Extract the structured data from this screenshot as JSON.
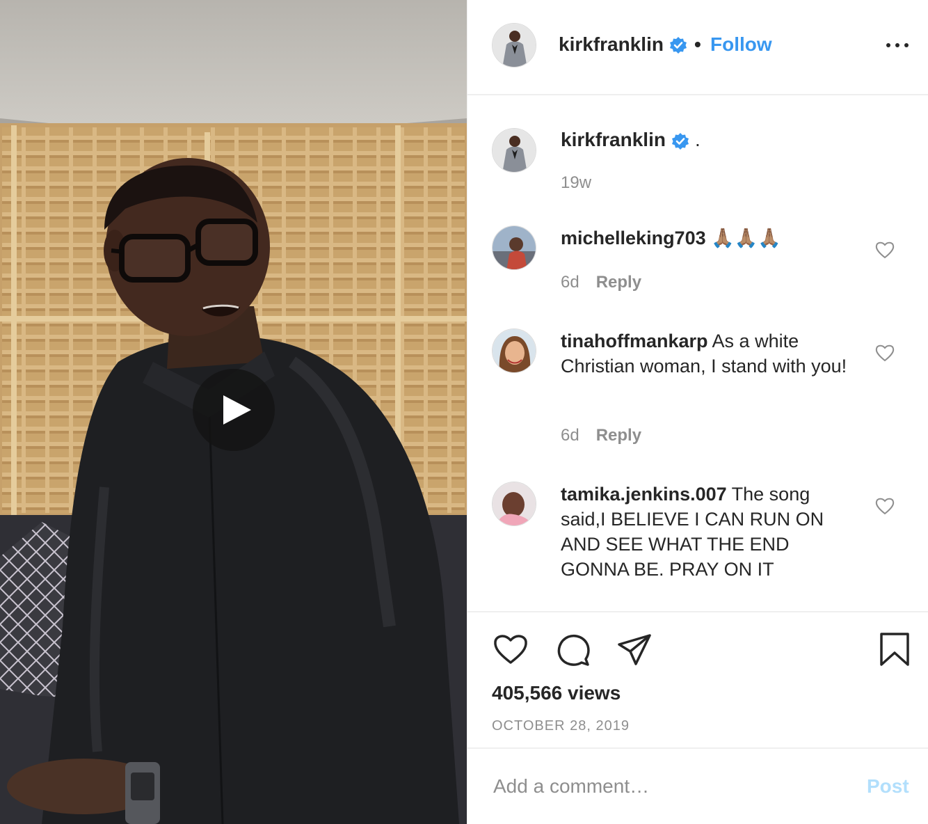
{
  "post": {
    "author": "kirkfranklin",
    "follow_label": "Follow",
    "separator": "•",
    "caption_text": ".",
    "caption_time": "19w",
    "views": "405,566 views",
    "date": "OCTOBER 28, 2019"
  },
  "comments": [
    {
      "username": "michelleking703",
      "text": "🙏🏽🙏🏽🙏🏽",
      "time": "6d",
      "reply_label": "Reply"
    },
    {
      "username": "tinahoffmankarp",
      "text": "As a white Christian woman, I stand with you!",
      "time": "6d",
      "reply_label": "Reply"
    },
    {
      "username": "tamika.jenkins.007",
      "text": "The song said,I BELIEVE I CAN RUN ON AND SEE WHAT THE END GONNA BE. PRAY ON IT"
    }
  ],
  "add_comment": {
    "placeholder": "Add a comment…",
    "post_label": "Post"
  },
  "colors": {
    "link": "#3897f0",
    "post_disabled": "#b2dffc",
    "muted": "#8e8e8e",
    "verified": "#3897f0"
  },
  "icons": [
    "play-icon",
    "verified-badge-icon",
    "more-options-icon",
    "heart-icon",
    "comment-icon",
    "share-icon",
    "bookmark-icon"
  ]
}
